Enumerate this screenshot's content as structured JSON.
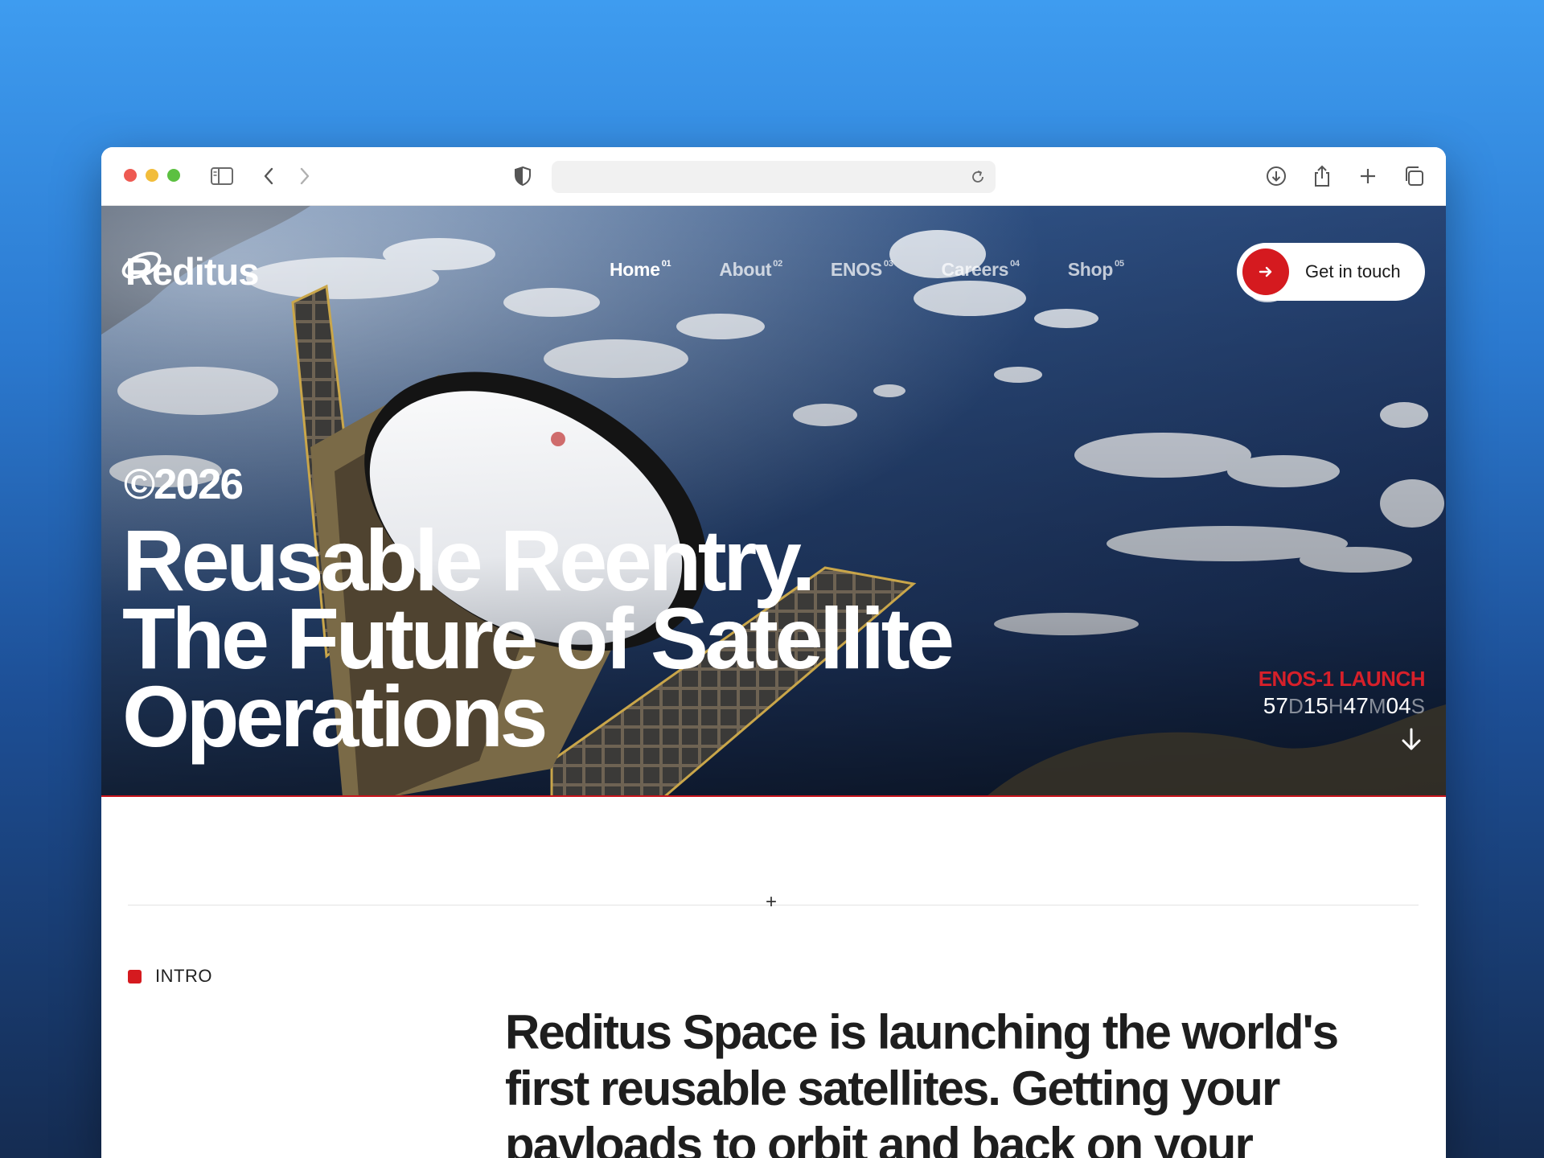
{
  "browser": {
    "url": "",
    "icons": [
      "sidebar-icon",
      "back-icon",
      "forward-icon",
      "shield-icon",
      "reload-icon",
      "download-icon",
      "share-icon",
      "new-tab-icon",
      "tabs-overview-icon"
    ]
  },
  "site": {
    "logo": "Reditus",
    "nav": [
      {
        "label": "Home",
        "num": "01",
        "active": true
      },
      {
        "label": "About",
        "num": "02",
        "active": false
      },
      {
        "label": "ENOS",
        "num": "03",
        "active": false
      },
      {
        "label": "Careers",
        "num": "04",
        "active": false
      },
      {
        "label": "Shop",
        "num": "05",
        "active": false
      }
    ],
    "cta": "Get in touch"
  },
  "hero": {
    "copyright": "©2026",
    "headline": [
      "Reusable Reentry.",
      "The Future of Satellite",
      "Operations"
    ],
    "launch_title": "ENOS-1 LAUNCH",
    "countdown": {
      "days": "57",
      "d": "D",
      "hours": "15",
      "h": "H",
      "minutes": "47",
      "m": "M",
      "seconds": "04",
      "s": "S"
    }
  },
  "intro": {
    "label": "INTRO",
    "text": "Reditus Space is launching the world's first reusable satellites. Getting your payloads to orbit and back on your"
  },
  "colors": {
    "accent": "#d51a1f",
    "ink": "#1e1e1e"
  }
}
